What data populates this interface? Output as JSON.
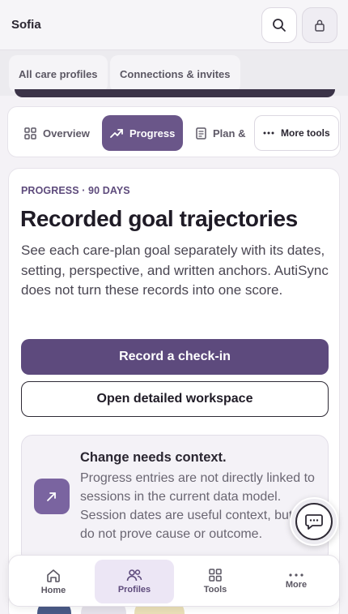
{
  "app": {
    "title": "Sofia"
  },
  "subnav": {
    "items": [
      "All care profiles",
      "Connections & invites"
    ]
  },
  "tabs": {
    "overview": "Overview",
    "progress": "Progress",
    "plan": "Plan &",
    "more": "More tools"
  },
  "main": {
    "eyebrow": "PROGRESS · 90 DAYS",
    "heading": "Recorded goal trajectories",
    "description": "See each care-plan goal separately with its dates, setting, perspective, and written anchors. AutiSync does not turn these records into one score.",
    "primary_button": "Record a check-in",
    "secondary_button": "Open detailed workspace",
    "note": {
      "title": "Change needs context.",
      "text": "Progress entries are not directly linked to sessions in the current data model. Session dates are useful context, but they do not prove cause or outcome."
    }
  },
  "bottom_nav": [
    "Home",
    "Profiles",
    "Tools",
    "More"
  ],
  "colors": {
    "accent": "#5d4a7d",
    "active_tab": "#6a5689",
    "background": "#f4f2f6"
  }
}
